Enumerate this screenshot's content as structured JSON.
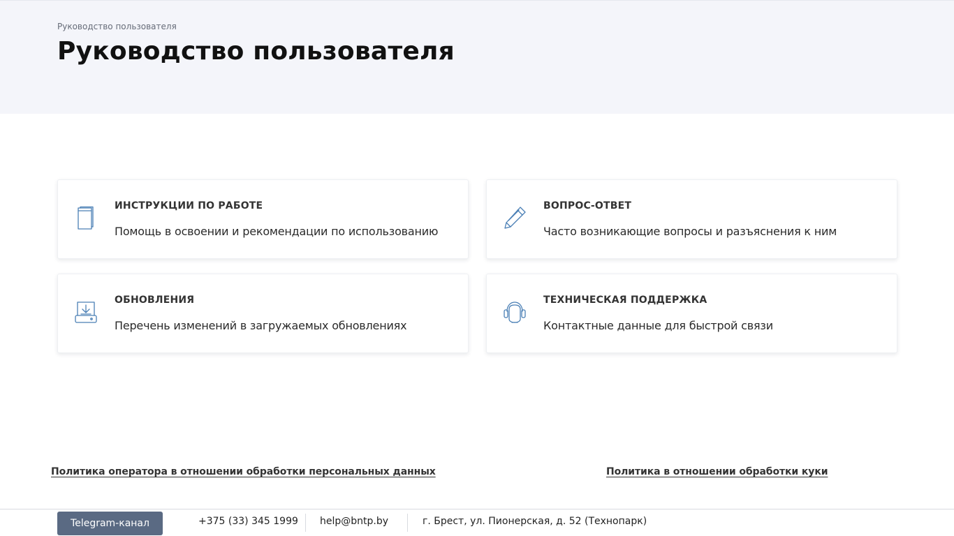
{
  "header": {
    "breadcrumb": "Руководство пользователя",
    "title": "Руководство пользователя"
  },
  "cards": [
    {
      "title": "ИНСТРУКЦИИ ПО РАБОТЕ",
      "description": "Помощь в освоении и рекомендации по использованию",
      "icon": "book-icon"
    },
    {
      "title": "ВОПРОС-ОТВЕТ",
      "description": "Часто возникающие вопросы и разъяснения к ним",
      "icon": "pencil-icon"
    },
    {
      "title": "ОБНОВЛЕНИЯ",
      "description": "Перечень изменений в загружаемых обновлениях",
      "icon": "download-drive-icon"
    },
    {
      "title": "ТЕХНИЧЕСКАЯ ПОДДЕРЖКА",
      "description": "Контактные данные для быстрой связи",
      "icon": "headset-icon"
    }
  ],
  "policies": {
    "personal_data": "Политика оператора в отношении обработки персональных данных",
    "cookies": "Политика в отношении обработки куки"
  },
  "footer": {
    "telegram_label": "Telegram-канал",
    "phone": "+375 (33) 345 1999",
    "email": "help@bntp.by",
    "address": "г. Брест, ул. Пионерская, д. 52 (Технопарк)"
  },
  "colors": {
    "icon_stroke": "#4a7fb5",
    "hero_background": "#f4f5fa",
    "telegram_button": "#5a6a83"
  }
}
